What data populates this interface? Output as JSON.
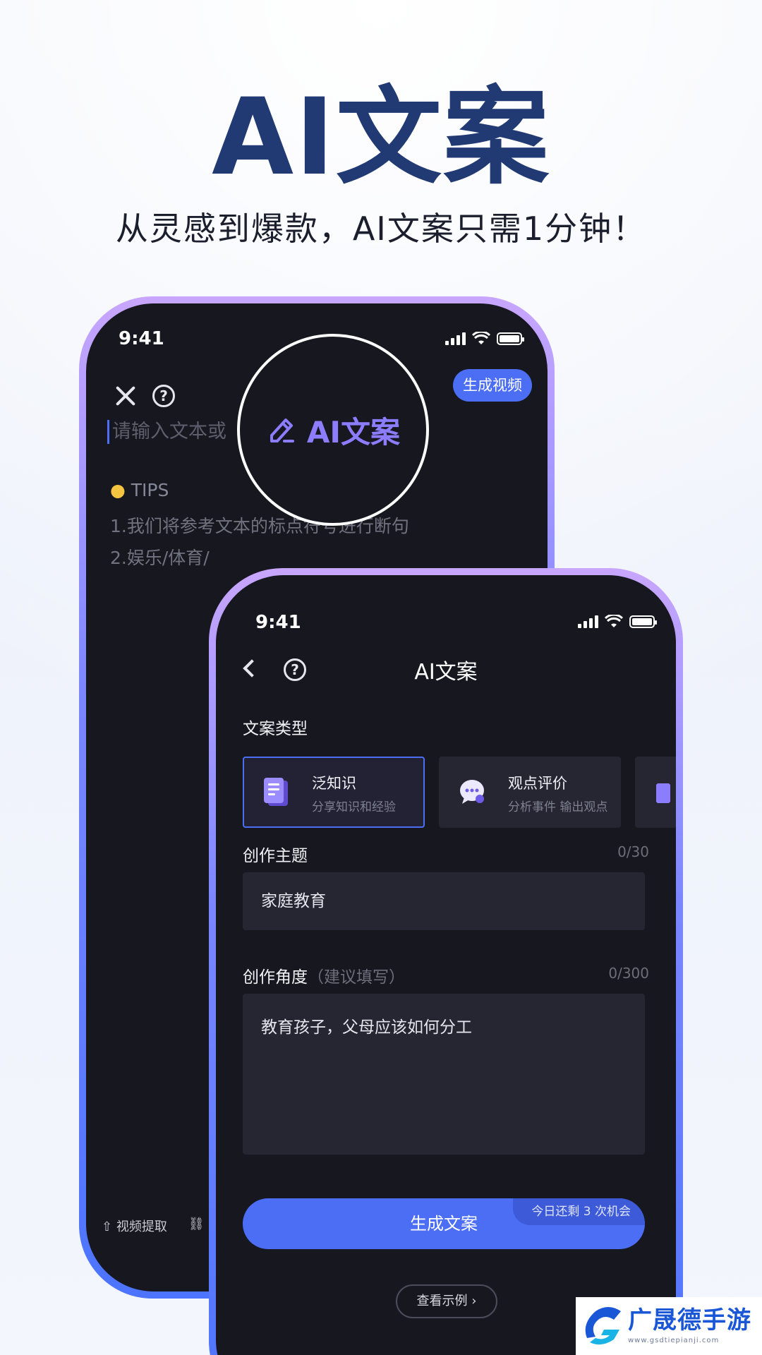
{
  "hero": {
    "title": "AI文案",
    "subtitle": "从灵感到爆款，AI文案只需1分钟！"
  },
  "back_phone": {
    "time": "9:41",
    "generate_video_label": "生成视频",
    "input_placeholder": "请输入文本或",
    "tips_title": "TIPS",
    "tips": [
      "1.我们将参考文本的标点符号进行断句",
      "2.娱乐/体育/"
    ],
    "bottom_tool": "视频提取"
  },
  "magnifier": {
    "label": "AI文案"
  },
  "front_phone": {
    "time": "9:41",
    "title": "AI文案",
    "type_section_label": "文案类型",
    "types": [
      {
        "title": "泛知识",
        "desc": "分享知识和经验"
      },
      {
        "title": "观点评价",
        "desc": "分析事件 输出观点"
      }
    ],
    "topic": {
      "label": "创作主题",
      "counter": "0/30",
      "value": "家庭教育"
    },
    "angle": {
      "label": "创作角度",
      "hint": "（建议填写）",
      "counter": "0/300",
      "value": "教育孩子，父母应该如何分工"
    },
    "generate_label": "生成文案",
    "quota_text": "今日还剩 3 次机会",
    "example_label": "查看示例 ›"
  },
  "watermark": {
    "brand": "广晟德手游",
    "url": "www.gsdtiepianji.com"
  },
  "colors": {
    "accent": "#4c6ef5",
    "hero_title": "#223a73",
    "phone_bg": "#17171f",
    "card_bg": "#262633"
  }
}
